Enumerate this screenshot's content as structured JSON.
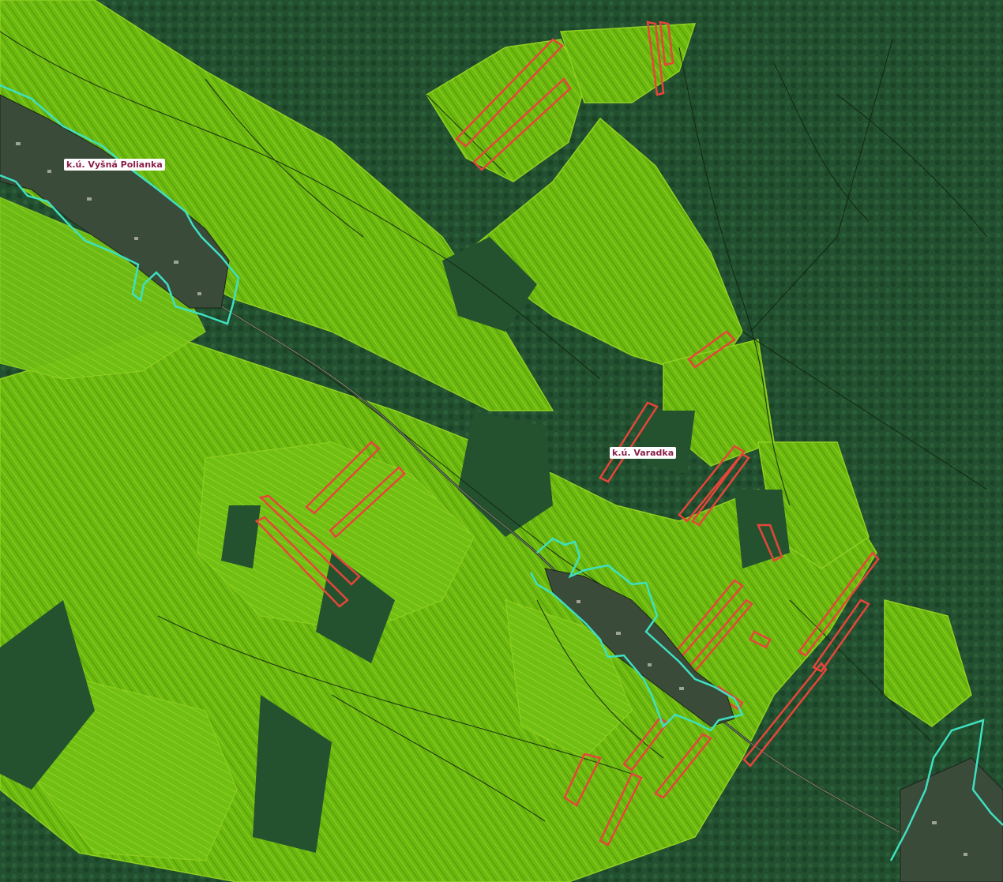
{
  "map": {
    "labels": {
      "vysna_polianka": "k.ú. Vyšná Polianka",
      "varadka": "k.ú. Varadka"
    },
    "layers": [
      {
        "name": "orthophoto",
        "type": "satellite imagery"
      },
      {
        "name": "cadastral-parcels",
        "color": "#6bb80f"
      },
      {
        "name": "highlighted-parcels",
        "color": "#e8453a"
      },
      {
        "name": "cadastral-boundary",
        "color": "#3fe0c0"
      }
    ],
    "colors": {
      "forest_dark": "#1f4a2a",
      "forest_mid": "#2d6138",
      "parcel_fill": "#6bb80f",
      "parcel_line": "#9fd92a",
      "highlight": "#e8453a",
      "boundary": "#3fe0c0",
      "road": "#1a2a1a"
    }
  }
}
